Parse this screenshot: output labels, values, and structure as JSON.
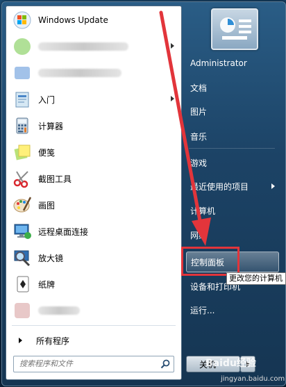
{
  "programs": [
    {
      "label": "Windows Update",
      "icon": "windows-update-icon",
      "blurred": false,
      "submenu": false
    },
    {
      "label": "",
      "icon": "blurred-app-icon",
      "blurred": true,
      "submenu": true
    },
    {
      "label": "",
      "icon": "blurred-app-icon",
      "blurred": true,
      "submenu": false
    },
    {
      "label": "入门",
      "icon": "getting-started-icon",
      "blurred": false,
      "submenu": true
    },
    {
      "label": "计算器",
      "icon": "calculator-icon",
      "blurred": false,
      "submenu": false
    },
    {
      "label": "便笺",
      "icon": "sticky-notes-icon",
      "blurred": false,
      "submenu": false
    },
    {
      "label": "截图工具",
      "icon": "snipping-tool-icon",
      "blurred": false,
      "submenu": false
    },
    {
      "label": "画图",
      "icon": "paint-icon",
      "blurred": false,
      "submenu": false
    },
    {
      "label": "远程桌面连接",
      "icon": "remote-desktop-icon",
      "blurred": false,
      "submenu": false
    },
    {
      "label": "放大镜",
      "icon": "magnifier-icon",
      "blurred": false,
      "submenu": false
    },
    {
      "label": "纸牌",
      "icon": "solitaire-icon",
      "blurred": false,
      "submenu": false
    },
    {
      "label": "",
      "icon": "blurred-app-icon",
      "blurred": true,
      "submenu": false
    }
  ],
  "all_programs": "所有程序",
  "search": {
    "placeholder": "搜索程序和文件"
  },
  "right": {
    "username": "Administrator",
    "documents": "文档",
    "pictures": "图片",
    "music": "音乐",
    "games": "游戏",
    "recent": "最近使用的项目",
    "computer": "计算机",
    "network": "网络",
    "control_panel": "控制面板",
    "devices": "设备和打印机",
    "run": "运行..."
  },
  "tooltip": "更改您的计算机",
  "shutdown": "关机",
  "watermark": "Baidu经验",
  "watermark_sub": "jingyan.baidu.com",
  "colors": {
    "highlight": "#e2353b"
  }
}
